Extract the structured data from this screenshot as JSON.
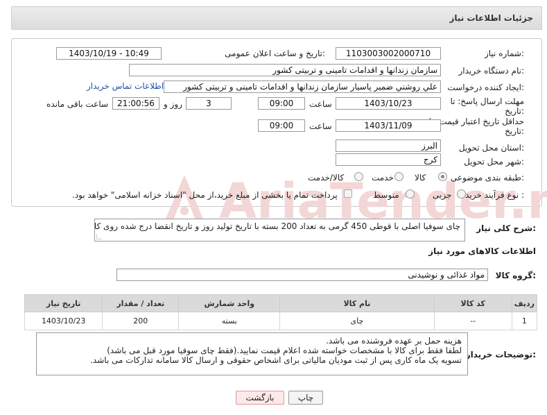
{
  "header": {
    "title": "جزئیات اطلاعات نیاز"
  },
  "form": {
    "need_number_label": "شماره نیاز:",
    "need_number": "1103003002000710",
    "announce_label": "تاریخ و ساعت اعلان عمومی:",
    "announce_value": "1403/10/19 - 10:49",
    "buyer_org_label": "نام دستگاه خریدار:",
    "buyer_org": "سازمان زندانها و اقدامات تامینی و تربیتی کشور",
    "creator_label": "ایجاد کننده درخواست:",
    "creator": "علي روشني ضمير پاسيار سازمان زندانها و اقدامات تامینی و تربیتی کشور",
    "contact_link": "اطلاعات تماس خریدار",
    "deadline_label_1": "مهلت ارسال پاسخ: تا",
    "deadline_label_2": "تاریخ:",
    "deadline_date": "1403/10/23",
    "time_label": "ساعت",
    "deadline_time": "09:00",
    "days_value": "3",
    "days_label": "روز و",
    "remaining_time": "21:00:56",
    "remaining_label": "ساعت باقی مانده",
    "validity_label_1": "حداقل تاریخ اعتبار قیمت: تا",
    "validity_label_2": "تاریخ:",
    "validity_date": "1403/11/09",
    "validity_time": "09:00",
    "province_label": "استان محل تحویل:",
    "province": "البرز",
    "city_label": "شهر محل تحویل:",
    "city": "کرج",
    "category_label": "طبقه بندی موضوعی:",
    "category_options": [
      "کالا",
      "خدمت",
      "کالا/خدمت"
    ],
    "category_selected": "کالا",
    "process_label": "نوع فرآیند خرید :",
    "process_options": [
      "جزیی",
      "متوسط"
    ],
    "payment_text": "پرداخت تمام یا بخشی از مبلغ خرید،از محل \"اسناد خزانه اسلامی\" خواهد بود."
  },
  "description": {
    "label": "شرح کلی نیاز:",
    "text": "چای سوفیا اصلی با قوطی 450 گرمی به تعداد 200 بسته با تاریخ  تولید روز و تاریخ انقضا درج شده روی کالا"
  },
  "goods": {
    "section_title": "اطلاعات کالاهای مورد نیاز",
    "group_label": "گروه کالا:",
    "group_value": "مواد غذائی و نوشیدنی",
    "columns": [
      "ردیف",
      "کد کالا",
      "نام کالا",
      "واحد شمارش",
      "تعداد / مقدار",
      "تاریخ نیاز"
    ],
    "rows": [
      [
        "1",
        "--",
        "چای",
        "بسته",
        "200",
        "1403/10/23"
      ]
    ]
  },
  "notes": {
    "label": "توضیحات خریدار:",
    "lines": [
      "هزینه حمل بر عهده فروشنده می باشد.",
      "لطفا فقط برای کالا با مشخصات خواسته شده اعلام قیمت نمایید.(فقط چای سوفیا مورد قبل می باشد)",
      "تسویه یک ماه کاری پس از ثبت مودیان مالیاتی برای اشخاص حقوقی و ارسال کالا سامانه تدارکات می باشد."
    ]
  },
  "buttons": {
    "print": "چاپ",
    "back": "بازگشت"
  },
  "watermark": {
    "text": "AriaTender.neT"
  },
  "colors": {
    "link": "#1f4fa8",
    "back_button": "#fde8ea",
    "watermark": "#f3d6d6"
  }
}
